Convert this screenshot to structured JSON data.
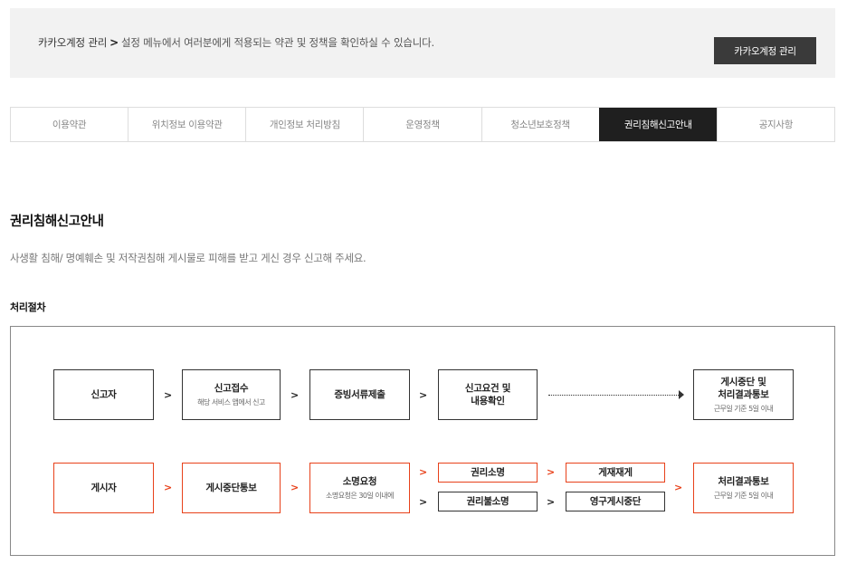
{
  "notice": {
    "link": "카카오계정 관리",
    "arrow": ">",
    "text": "설정 메뉴에서 여러분에게 적용되는 약관 및 정책을 확인하실 수 있습니다.",
    "button": "카카오계정 관리"
  },
  "tabs": [
    {
      "label": "이용약관",
      "active": false
    },
    {
      "label": "위치정보 이용약관",
      "active": false
    },
    {
      "label": "개인정보 처리방침",
      "active": false
    },
    {
      "label": "운영정책",
      "active": false
    },
    {
      "label": "청소년보호정책",
      "active": false
    },
    {
      "label": "권리침해신고안내",
      "active": true
    },
    {
      "label": "공지사항",
      "active": false
    }
  ],
  "page": {
    "title": "권리침해신고안내",
    "description": "사생활 침해/ 명예훼손 및 저작권침해 게시물로 피해를 받고 게신 경우 신고해 주세요.",
    "section_title": "처리절차"
  },
  "flow": {
    "chevron": ">",
    "row1": {
      "reporter": "신고자",
      "receipt": "신고접수",
      "receipt_sub": "해당 서비스 앱에서 신고",
      "evidence": "증빙서류제출",
      "review_line1": "신고요건 및",
      "review_line2": "내용확인",
      "result_line1": "게시중단 및",
      "result_line2": "처리결과통보",
      "result_sub": "근무일 기준 5일 이내"
    },
    "row2": {
      "poster": "게시자",
      "suspend_notice": "게시중단통보",
      "appeal": "소명요청",
      "appeal_sub": "소명요청은 30일 이내에",
      "vindicated": "권리소명",
      "not_vindicated": "권리불소명",
      "repost": "게재재게",
      "perm_suspend": "영구게시중단",
      "result": "처리결과통보",
      "result_sub": "근무일 기준 5일 이내"
    }
  },
  "colors": {
    "accent": "#e8411a",
    "active_tab": "#1f1f1f",
    "notice_bg": "#f2f2f2",
    "button_bg": "#3a3a3a"
  }
}
